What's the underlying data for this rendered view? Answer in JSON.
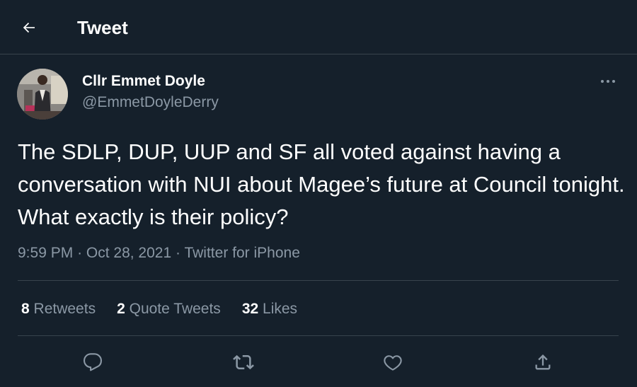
{
  "header": {
    "title": "Tweet",
    "back_icon": "arrow-left-icon"
  },
  "tweet": {
    "author": {
      "display_name": "Cllr Emmet Doyle",
      "handle": "@EmmetDoyleDerry"
    },
    "text": "The SDLP, DUP, UUP and SF all voted against having a conversation with NUI about Magee’s future at Council tonight.  What exactly is their policy?",
    "time": "9:59 PM",
    "date": "Oct 28, 2021",
    "source": "Twitter for iPhone",
    "separator": "·",
    "stats": {
      "retweets_count": "8",
      "retweets_label": "Retweets",
      "quotes_count": "2",
      "quotes_label": "Quote Tweets",
      "likes_count": "32",
      "likes_label": "Likes"
    }
  },
  "actions": {
    "reply_icon": "reply-icon",
    "retweet_icon": "retweet-icon",
    "like_icon": "heart-icon",
    "share_icon": "share-icon"
  },
  "colors": {
    "background": "#15202b",
    "primary_text": "#ffffff",
    "secondary_text": "#8b98a5",
    "border": "#38444d"
  }
}
